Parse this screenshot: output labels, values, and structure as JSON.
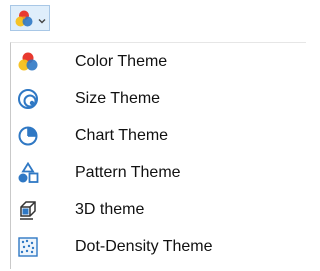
{
  "toolbar": {
    "theme_button_icon": "color-theme-icon",
    "dropdown_icon": "chevron-down-icon"
  },
  "menu": {
    "items": [
      {
        "label": "Color Theme",
        "icon": "color-theme-icon"
      },
      {
        "label": "Size Theme",
        "icon": "size-theme-icon"
      },
      {
        "label": "Chart Theme",
        "icon": "chart-theme-icon"
      },
      {
        "label": "Pattern Theme",
        "icon": "pattern-theme-icon"
      },
      {
        "label": "3D theme",
        "icon": "3d-theme-icon"
      },
      {
        "label": "Dot-Density Theme",
        "icon": "dot-density-theme-icon"
      }
    ]
  },
  "colors": {
    "button_hover_bg": "#dfeefb",
    "button_hover_border": "#a8c7e6",
    "icon_blue": "#2f78c4"
  }
}
